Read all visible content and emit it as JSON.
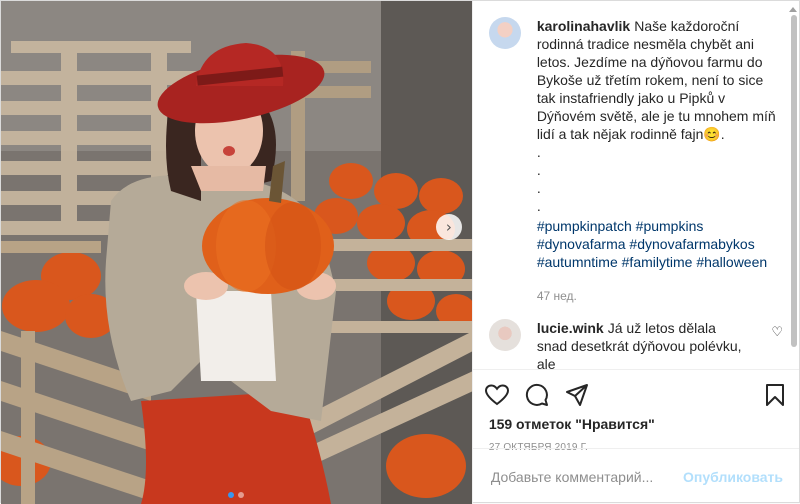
{
  "caption": {
    "username": "karolinahavlik",
    "text": "Naše každoroční rodinná tradice nesměla chybět ani letos. Jezdíme na dýňovou farmu do Bykoše už třetím rokem, není to sice tak instafriendly jako u Pipků v Dýňovém světě, ale je tu mnohem míň lidí a tak nějak rodinně fajn😊.\n.\n.\n.\n.",
    "hashtags": [
      "#pumpkinpatch",
      "#pumpkins",
      "#dynovafarma",
      "#dynovafarmabykos",
      "#autumntime",
      "#familytime",
      "#halloween"
    ],
    "time": "47 нед."
  },
  "comment": {
    "username": "lucie.wink",
    "text": "Já už letos dělala snad desetkrát dýňovou polévku, ale"
  },
  "actions": {
    "like_icon": "heart-icon",
    "comment_icon": "comment-icon",
    "share_icon": "share-icon",
    "save_icon": "bookmark-icon"
  },
  "likes": "159 отметок \"Нравится\"",
  "date": "27 ОКТЯБРЯ 2019 Г.",
  "add_comment": {
    "placeholder": "Добавьте комментарий...",
    "publish_label": "Опубликовать"
  },
  "media": {
    "carousel_position": 1,
    "carousel_total": 2,
    "next_icon": "chevron-right-icon"
  }
}
